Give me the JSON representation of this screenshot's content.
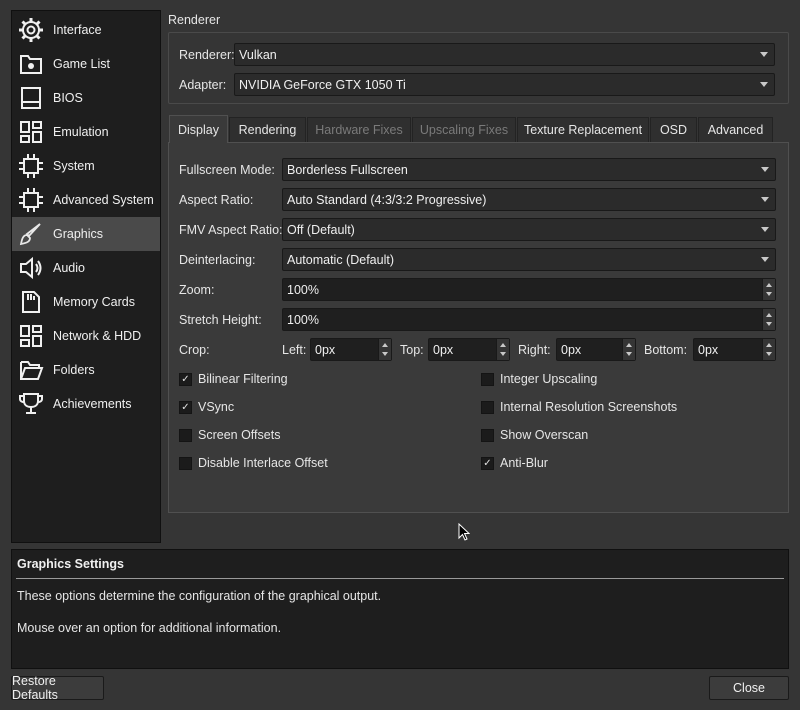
{
  "sidebar": {
    "items": [
      {
        "label": "Interface",
        "icon": "gear-icon"
      },
      {
        "label": "Game List",
        "icon": "folder-settings-icon"
      },
      {
        "label": "BIOS",
        "icon": "bios-chip-icon"
      },
      {
        "label": "Emulation",
        "icon": "grid-icon"
      },
      {
        "label": "System",
        "icon": "cpu-icon"
      },
      {
        "label": "Advanced System",
        "icon": "cpu-icon"
      },
      {
        "label": "Graphics",
        "icon": "brush-icon"
      },
      {
        "label": "Audio",
        "icon": "speaker-icon"
      },
      {
        "label": "Memory Cards",
        "icon": "memory-card-icon"
      },
      {
        "label": "Network & HDD",
        "icon": "grid-icon"
      },
      {
        "label": "Folders",
        "icon": "folder-open-icon"
      },
      {
        "label": "Achievements",
        "icon": "trophy-icon"
      }
    ],
    "active": "Graphics"
  },
  "renderer_group": {
    "title": "Renderer",
    "renderer_label": "Renderer:",
    "renderer_value": "Vulkan",
    "adapter_label": "Adapter:",
    "adapter_value": "NVIDIA GeForce GTX 1050 Ti"
  },
  "tabs": [
    {
      "label": "Display",
      "state": "active"
    },
    {
      "label": "Rendering",
      "state": "normal"
    },
    {
      "label": "Hardware Fixes",
      "state": "disabled"
    },
    {
      "label": "Upscaling Fixes",
      "state": "disabled"
    },
    {
      "label": "Texture Replacement",
      "state": "normal"
    },
    {
      "label": "OSD",
      "state": "normal"
    },
    {
      "label": "Advanced",
      "state": "normal"
    }
  ],
  "display": {
    "fullscreen_label": "Fullscreen Mode:",
    "fullscreen_value": "Borderless Fullscreen",
    "aspect_label": "Aspect Ratio:",
    "aspect_value": "Auto Standard (4:3/3:2 Progressive)",
    "fmv_label": "FMV Aspect Ratio:",
    "fmv_value": "Off (Default)",
    "deinterlace_label": "Deinterlacing:",
    "deinterlace_value": "Automatic (Default)",
    "zoom_label": "Zoom:",
    "zoom_value": "100%",
    "stretch_label": "Stretch Height:",
    "stretch_value": "100%",
    "crop": {
      "label": "Crop:",
      "left_label": "Left:",
      "left_value": "0px",
      "top_label": "Top:",
      "top_value": "0px",
      "right_label": "Right:",
      "right_value": "0px",
      "bottom_label": "Bottom:",
      "bottom_value": "0px"
    },
    "checkboxes": [
      {
        "label": "Bilinear Filtering",
        "checked": true
      },
      {
        "label": "Integer Upscaling",
        "checked": false
      },
      {
        "label": "VSync",
        "checked": true
      },
      {
        "label": "Internal Resolution Screenshots",
        "checked": false
      },
      {
        "label": "Screen Offsets",
        "checked": false
      },
      {
        "label": "Show Overscan",
        "checked": false
      },
      {
        "label": "Disable Interlace Offset",
        "checked": false
      },
      {
        "label": "Anti-Blur",
        "checked": true
      }
    ]
  },
  "description": {
    "title": "Graphics Settings",
    "line1": "These options determine the configuration of the graphical output.",
    "line2": "Mouse over an option for additional information."
  },
  "buttons": {
    "restore": "Restore Defaults",
    "close": "Close"
  },
  "check_glyph": "✓"
}
